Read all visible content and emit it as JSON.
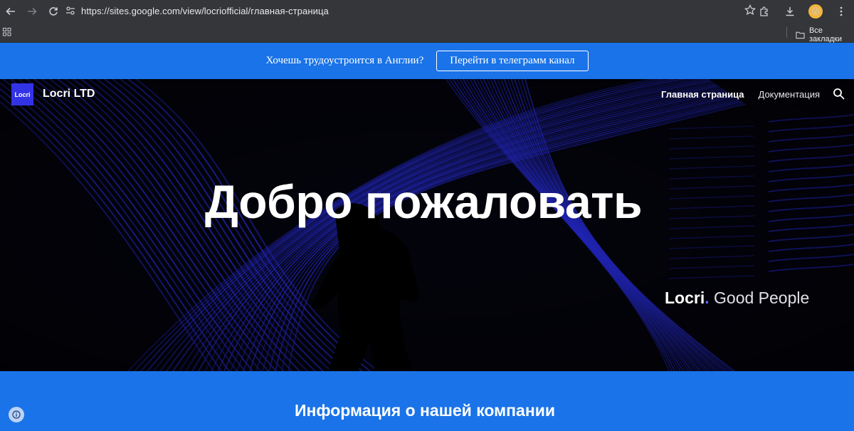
{
  "browser": {
    "url": "https://sites.google.com/view/locriofficial/главная-страница",
    "bookmarks_folder": "Все закладки"
  },
  "banner": {
    "message": "Хочешь трудоустроится в Англии?",
    "button_label": "Перейти в телеграмм канал"
  },
  "header": {
    "logo_text": "Locri",
    "site_title": "Locri LTD",
    "nav": [
      {
        "label": "Главная страница",
        "active": true
      },
      {
        "label": "Документация",
        "active": false
      }
    ]
  },
  "hero": {
    "title": "Добро пожаловать",
    "tagline_brand": "Locri",
    "tagline_dot": ".",
    "tagline_rest": "Good People"
  },
  "info": {
    "title": "Информация о нашей компании"
  },
  "colors": {
    "accent": "#1a73e8",
    "logo_bg": "#3333e6",
    "hero_lines": "#2f35ff",
    "chrome": "#35363a"
  }
}
